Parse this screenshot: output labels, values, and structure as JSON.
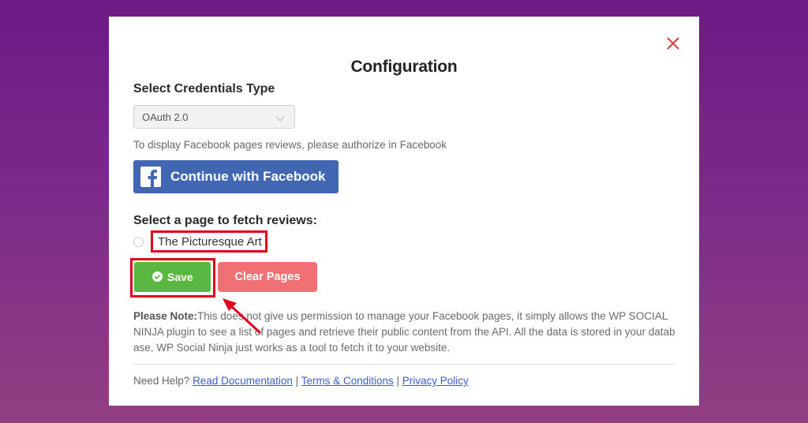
{
  "modal": {
    "title": "Configuration",
    "close_icon": "close-icon"
  },
  "credentials": {
    "label": "Select Credentials Type",
    "selected": "OAuth 2.0",
    "hint": "To display Facebook pages reviews, please authorize in Facebook"
  },
  "facebook_button": {
    "label": "Continue with Facebook",
    "icon": "facebook-logo-icon",
    "color": "#4267b2"
  },
  "pages": {
    "label": "Select a page to fetch reviews:",
    "items": [
      {
        "name": "The Picturesque Art",
        "checked": false
      }
    ]
  },
  "actions": {
    "save_label": "Save",
    "clear_label": "Clear Pages",
    "save_color": "#5ab73f",
    "clear_color": "#f17073"
  },
  "note": {
    "prefix": "Please Note:",
    "text": "This does not give us permission to manage your Facebook pages, it simply allows the WP SOCIAL NINJA plugin to see a list of pages and retrieve their public content from the API. All the data is stored in your database, WP Social Ninja just works as a tool to fetch it to your website."
  },
  "help": {
    "prefix": "Need Help?",
    "links": [
      "Read Documentation",
      "Terms & Conditions",
      "Privacy Policy"
    ],
    "separator": "|"
  },
  "annotations": {
    "highlight_color": "#e0001b"
  }
}
